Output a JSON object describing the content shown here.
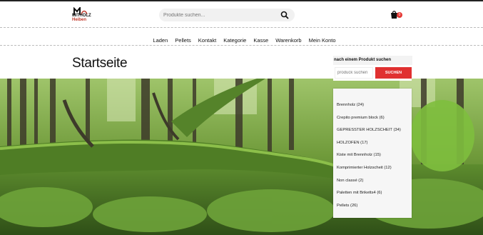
{
  "header": {
    "logo": {
      "line1": "MITHOLZ",
      "line2": "Heiben"
    },
    "search_placeholder": "Produkte suchen...",
    "cart_count": "0"
  },
  "nav": {
    "items": [
      "Laden",
      "Pellets",
      "Kontakt",
      "Kategorie",
      "Kasse",
      "Warenkorb",
      "Mein Konto"
    ]
  },
  "page": {
    "title": "Startseite"
  },
  "sidebar": {
    "search_title": "nach einem Produkt suchen",
    "search_placeholder": "produck suchen",
    "search_button": "SUCHEN",
    "categories": [
      "Brennholz (24)",
      "Crepito premium block (6)",
      "GEPRESSTER HOLZSCHEIT (34)",
      "HOLZOFEN (17)",
      "Kiste mit Brennholz (15)",
      "Komprimierter Holzscheit (12)",
      "Non classé (2)",
      "Paletten mit Briketts4 (6)",
      "Pellets (26)"
    ]
  },
  "colors": {
    "accent": "#e03030",
    "forest_dark": "#2e4a1b",
    "moss": "#5d8c2e"
  }
}
